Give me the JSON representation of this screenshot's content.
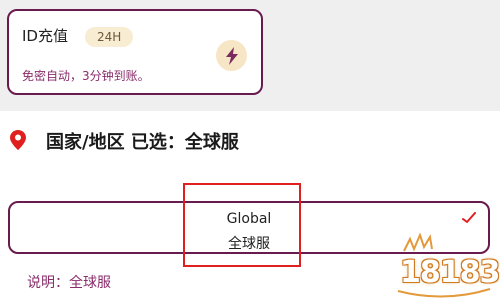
{
  "topup_card": {
    "title": "ID充值",
    "badge": "24H",
    "description": "免密自动，3分钟到账。"
  },
  "region": {
    "label": "国家/地区 已选：全球服"
  },
  "server_option": {
    "name_en": "Global",
    "name_cn": "全球服",
    "selected": true
  },
  "note": {
    "text": "说明：全球服"
  },
  "watermark": {
    "text": "18183"
  },
  "colors": {
    "accent": "#6a1b4d",
    "highlight": "#e0201f",
    "badge_bg": "#f8ecd3",
    "note_text": "#8a2d6b"
  },
  "icons": {
    "lightning": "lightning-icon",
    "location": "location-pin-icon",
    "check": "check-icon"
  }
}
